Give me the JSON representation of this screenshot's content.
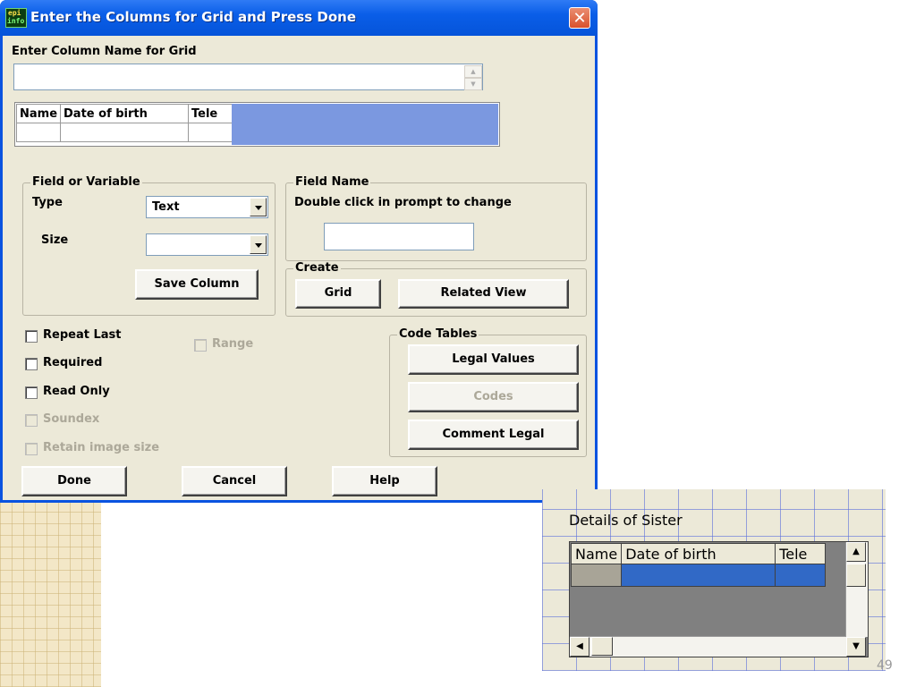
{
  "window": {
    "title": "Enter the Columns for Grid and Press Done",
    "icon": "epi-info-app-icon",
    "icon_text_1": "epi",
    "icon_text_2": "info",
    "close_symbol": "✕",
    "colors": {
      "titlebar": "#0a5ee8",
      "client": "#ece9d8",
      "close": "#d9512c"
    }
  },
  "column_name": {
    "label": "Enter Column Name for Grid",
    "value": ""
  },
  "grid_preview": {
    "columns": [
      "Name",
      "Date of birth",
      "Tele"
    ]
  },
  "field_or_variable": {
    "group_title": "Field or Variable",
    "type_label": "Type",
    "type_value": "Text",
    "size_label": "Size",
    "size_value": "",
    "save_button": "Save Column"
  },
  "field_name": {
    "group_title": "Field Name",
    "hint": "Double click in prompt to change",
    "value": ""
  },
  "create": {
    "group_title": "Create",
    "grid_button": "Grid",
    "related_view_button": "Related View"
  },
  "options": {
    "repeat_last": "Repeat Last",
    "required": "Required",
    "read_only": "Read Only",
    "soundex": "Soundex",
    "retain_image_size": "Retain image size",
    "range": "Range"
  },
  "code_tables": {
    "group_title": "Code Tables",
    "legal_values": "Legal Values",
    "codes": "Codes",
    "comment_legal": "Comment Legal"
  },
  "footer": {
    "done": "Done",
    "cancel": "Cancel",
    "help": "Help"
  },
  "designer": {
    "title": "Details of Sister",
    "columns": [
      "Name",
      "Date of birth",
      "Tele"
    ],
    "selected_row_color": "#3169c6"
  },
  "slide_number": "49"
}
